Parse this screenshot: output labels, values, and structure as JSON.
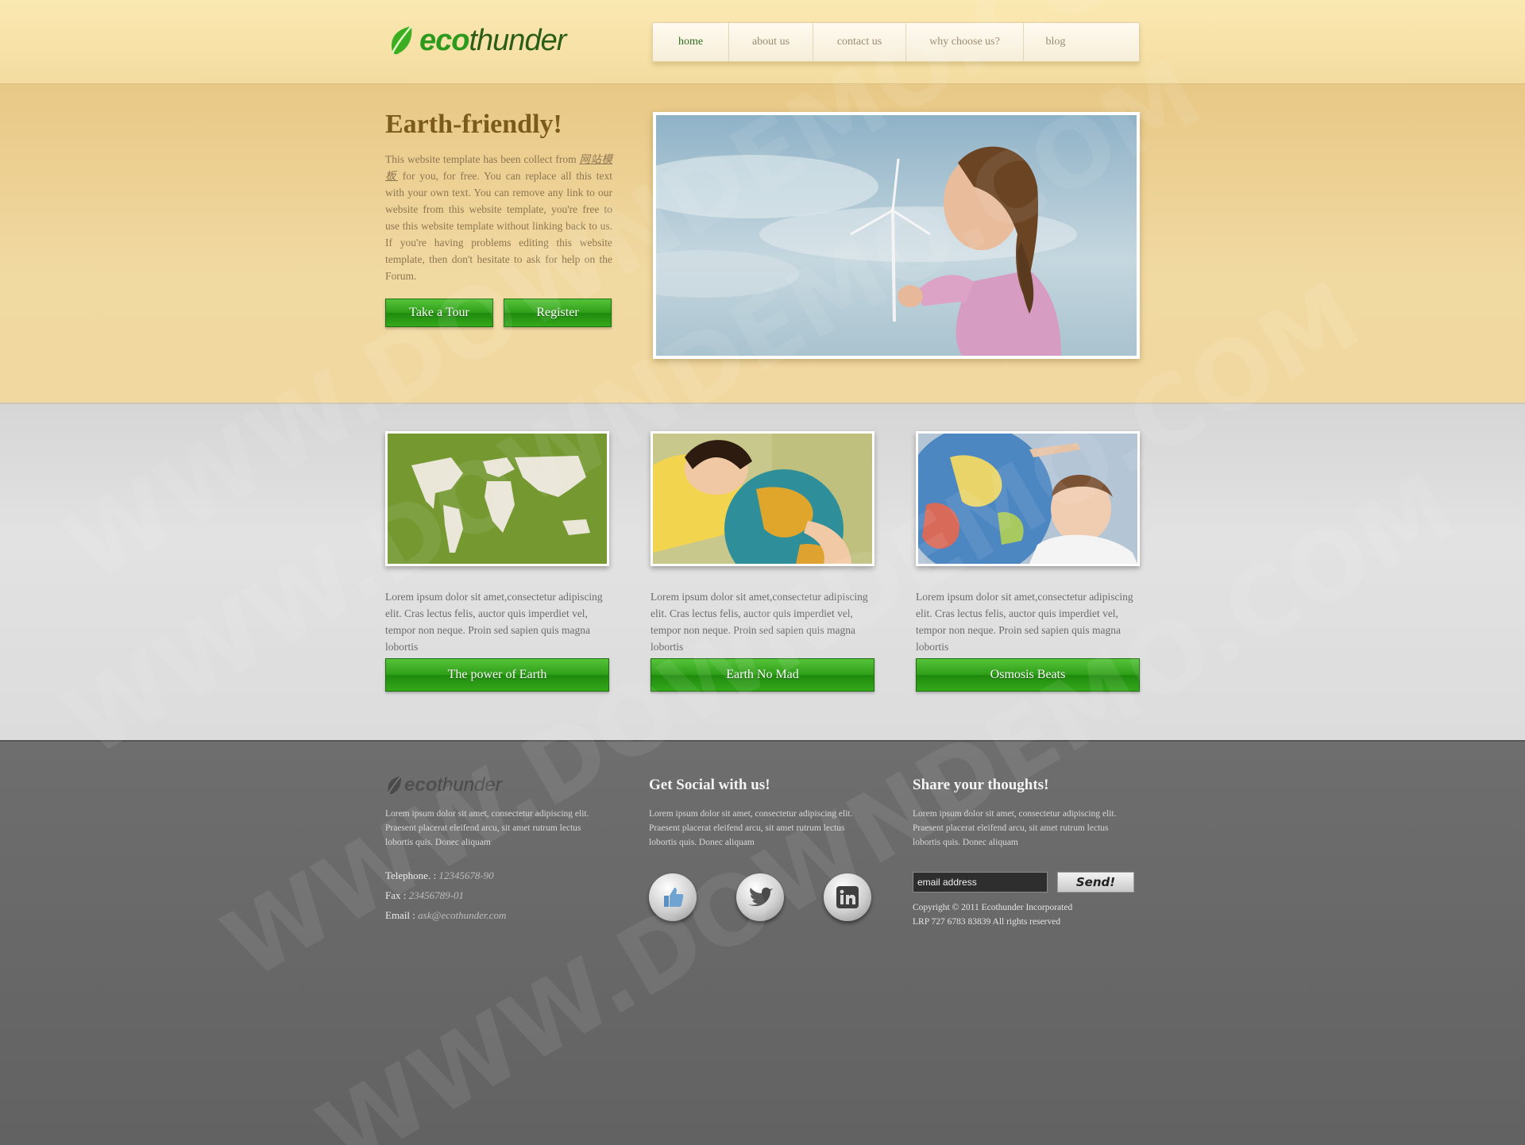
{
  "brand": {
    "eco": "eco",
    "thunder": "thunder"
  },
  "nav": [
    {
      "label": "home",
      "active": true
    },
    {
      "label": "about us"
    },
    {
      "label": "contact us"
    },
    {
      "label": "why choose us?"
    },
    {
      "label": "blog"
    }
  ],
  "hero": {
    "title": "Earth-friendly!",
    "text_before_link": "This website template has been collect from ",
    "link_text": "网站模板",
    "text_after_link": " for you, for free. You can replace all this text with your own text. You can remove any link to our website from this website template, you're free to use this website template without linking back to us. If you're having problems editing this website template, then don't hesitate to ask for help on the Forum.",
    "btn_tour": "Take a Tour",
    "btn_register": "Register"
  },
  "features": [
    {
      "image": "world-map-on-grass",
      "text": "Lorem ipsum dolor sit amet,consectetur adipiscing elit. Cras lectus felis, auctor quis imperdiet vel, tempor non neque. Proin sed sapien quis magna lobortis",
      "button": "The power of Earth"
    },
    {
      "image": "girl-hugging-globe",
      "text": "Lorem ipsum dolor sit amet,consectetur adipiscing elit. Cras lectus felis, auctor quis imperdiet vel, tempor non neque. Proin sed sapien quis magna lobortis",
      "button": "Earth No Mad"
    },
    {
      "image": "boy-with-globe",
      "text": "Lorem ipsum dolor sit amet,consectetur adipiscing elit. Cras lectus felis, auctor quis imperdiet vel, tempor non neque. Proin sed sapien quis magna lobortis",
      "button": "Osmosis Beats"
    }
  ],
  "footer": {
    "about": {
      "text": "Lorem ipsum dolor sit amet, consectetur adipiscing elit. Praesent placerat eleifend arcu, sit amet rutrum lectus lobortis quis. Donec aliquam",
      "telephone_label": "Telephone. : ",
      "telephone": "12345678-90",
      "fax_label": "Fax : ",
      "fax": "23456789-01",
      "email_label": "Email : ",
      "email": "ask@ecothunder.com"
    },
    "social": {
      "title": "Get Social with us!",
      "text": "Lorem ipsum dolor sit amet, consectetur adipiscing elit. Praesent placerat eleifend arcu, sit amet rutrum lectus lobortis quis. Donec aliquam",
      "icons": [
        "thumbs-up-icon",
        "twitter-icon",
        "linkedin-icon"
      ]
    },
    "thoughts": {
      "title": "Share your thoughts!",
      "text": "Lorem ipsum dolor sit amet, consectetur adipiscing elit. Praesent placerat eleifend arcu, sit amet rutrum lectus lobortis quis. Donec aliquam",
      "email_placeholder": "email address",
      "send_label": "Send!",
      "copyright_1": "Copyright © 2011 Ecothunder Incorporated",
      "copyright_2": "LRP 727 6783 83839 All rights reserved"
    }
  },
  "watermark": "WWW.DOWNDEMO.COM",
  "colors": {
    "green": "#2e9e18",
    "header_bg": "#f4dca0",
    "hero_title": "#7c5a1b",
    "footer_bg": "#666666"
  }
}
